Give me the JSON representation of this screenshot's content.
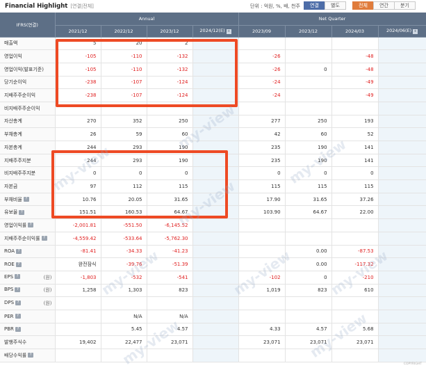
{
  "header": {
    "title": "Financial Highlight",
    "subtitle": "[연결|전체]",
    "unit": "단위 : 억원, %, 배, 천주",
    "tabs_type": [
      "연결",
      "별도"
    ],
    "tabs_period": [
      "전체",
      "연간",
      "분기"
    ]
  },
  "table": {
    "corner": "IFRS(연결)",
    "group_annual": "Annual",
    "group_quarter": "Net Quarter",
    "annual_cols": [
      "2021/12",
      "2022/12",
      "2023/12",
      "2024/12(E)"
    ],
    "quarter_cols": [
      "2023/09",
      "2023/12",
      "2024/03",
      "2024/06(E)"
    ],
    "rows": [
      {
        "label": "매출액",
        "values": [
          "5",
          "20",
          "2",
          "",
          "",
          "",
          "",
          ""
        ]
      },
      {
        "label": "영업이익",
        "values": [
          "-105",
          "-110",
          "-132",
          "",
          "-26",
          "",
          "-48",
          ""
        ]
      },
      {
        "label": "영업이익(발표기준)",
        "values": [
          "-105",
          "-110",
          "-132",
          "",
          "-26",
          "0",
          "-48",
          ""
        ]
      },
      {
        "label": "당기순이익",
        "values": [
          "-238",
          "-107",
          "-124",
          "",
          "-24",
          "",
          "-49",
          ""
        ]
      },
      {
        "label": "지배주주순이익",
        "values": [
          "-238",
          "-107",
          "-124",
          "",
          "-24",
          "",
          "-49",
          ""
        ]
      },
      {
        "label": "비지배주주순이익",
        "values": [
          "",
          "",
          "",
          "",
          "",
          "",
          "",
          ""
        ]
      },
      {
        "label": "자산총계",
        "values": [
          "270",
          "352",
          "250",
          "",
          "277",
          "250",
          "193",
          ""
        ]
      },
      {
        "label": "부채총계",
        "values": [
          "26",
          "59",
          "60",
          "",
          "42",
          "60",
          "52",
          ""
        ]
      },
      {
        "label": "자본총계",
        "values": [
          "244",
          "293",
          "190",
          "",
          "235",
          "190",
          "141",
          ""
        ]
      },
      {
        "label": "지배주주지분",
        "values": [
          "244",
          "293",
          "190",
          "",
          "235",
          "190",
          "141",
          ""
        ]
      },
      {
        "label": "비지배주주지분",
        "values": [
          "0",
          "0",
          "0",
          "",
          "0",
          "0",
          "0",
          ""
        ]
      },
      {
        "label": "자본금",
        "values": [
          "97",
          "112",
          "115",
          "",
          "115",
          "115",
          "115",
          ""
        ]
      },
      {
        "label": "부채비율",
        "values": [
          "10.76",
          "20.05",
          "31.65",
          "",
          "17.90",
          "31.65",
          "37.26",
          ""
        ],
        "q": true
      },
      {
        "label": "유보율",
        "values": [
          "151.51",
          "160.53",
          "64.67",
          "",
          "103.90",
          "64.67",
          "22.00",
          ""
        ],
        "q": true
      },
      {
        "label": "영업이익률",
        "values": [
          "-2,001.81",
          "-551.50",
          "-6,145.52",
          "",
          "",
          "",
          "",
          ""
        ],
        "q": true
      },
      {
        "label": "지배주주순이익률",
        "values": [
          "-4,559.42",
          "-533.64",
          "-5,762.30",
          "",
          "",
          "",
          "",
          ""
        ],
        "q": true
      },
      {
        "label": "ROA",
        "values": [
          "-81.41",
          "-34.33",
          "-41.23",
          "",
          "",
          "0.00",
          "-87.53",
          ""
        ],
        "q": true
      },
      {
        "label": "ROE",
        "values": [
          "완전잠식",
          "-39.76",
          "-51.39",
          "",
          "",
          "0.00",
          "-117.32",
          ""
        ],
        "q": true
      },
      {
        "label": "EPS",
        "values": [
          "-1,803",
          "-532",
          "-541",
          "",
          "-102",
          "0",
          "-210",
          ""
        ],
        "q": true,
        "won": "(원)"
      },
      {
        "label": "BPS",
        "values": [
          "1,258",
          "1,303",
          "823",
          "",
          "1,019",
          "823",
          "610",
          ""
        ],
        "q": true,
        "won": "(원)"
      },
      {
        "label": "DPS",
        "values": [
          "",
          "",
          "",
          "",
          "",
          "",
          "",
          ""
        ],
        "q": true,
        "won": "(원)"
      },
      {
        "label": "PER",
        "values": [
          "",
          "N/A",
          "N/A",
          "",
          "",
          "",
          "",
          ""
        ],
        "q": true
      },
      {
        "label": "PBR",
        "values": [
          "",
          "5.45",
          "4.57",
          "",
          "4.33",
          "4.57",
          "5.68",
          ""
        ],
        "q": true
      },
      {
        "label": "발행주식수",
        "values": [
          "19,402",
          "22,477",
          "23,071",
          "",
          "23,071",
          "23,071",
          "23,071",
          ""
        ]
      },
      {
        "label": "배당수익률",
        "values": [
          "",
          "",
          "",
          "",
          "",
          "",
          "",
          ""
        ],
        "q": true
      }
    ]
  },
  "watermark": "my-view",
  "footer": "COPYRIGHT",
  "colors": {
    "header_bg": "#5d6f86",
    "negative": "#e02020",
    "highlight": "#ee4a24",
    "tab_active": "#4d6da8",
    "tab_orange": "#e07c3c"
  }
}
